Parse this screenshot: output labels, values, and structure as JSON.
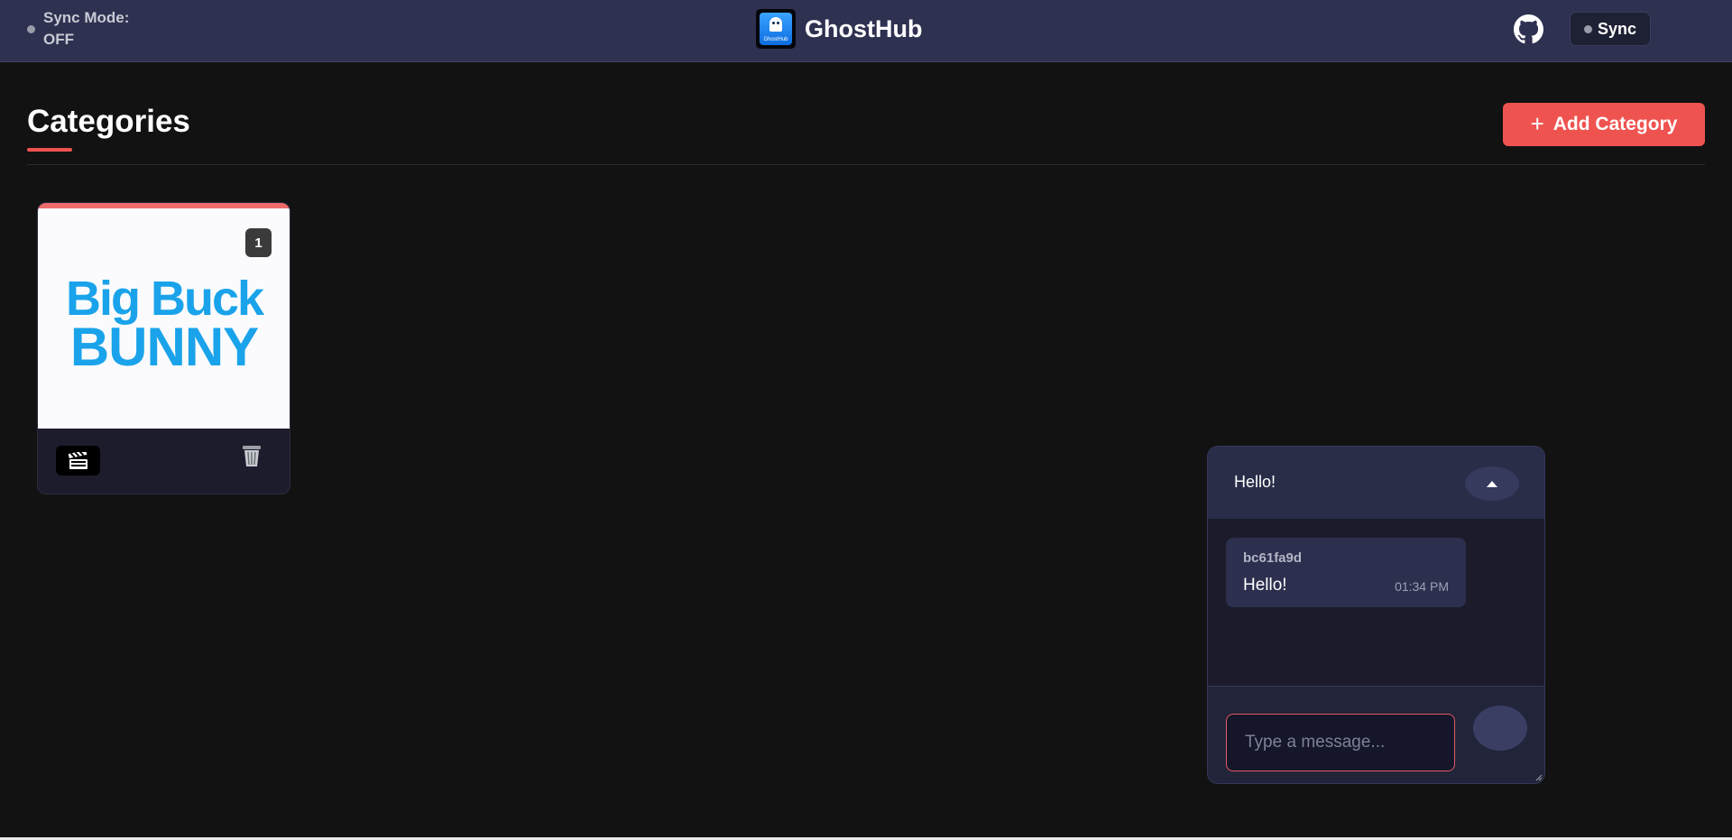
{
  "header": {
    "sync_mode_label": "Sync Mode:",
    "sync_mode_value": "OFF",
    "brand_name": "GhostHub",
    "logo_caption": "GhostHub",
    "github_icon": "github-icon",
    "sync_button_label": "Sync"
  },
  "page": {
    "title": "Categories",
    "add_button_label": "Add Category",
    "add_button_icon": "plus-icon",
    "accent_color": "#ef5350"
  },
  "categories": [
    {
      "thumbnail_text_line1": "Big Buck",
      "thumbnail_text_line2": "BUNNY",
      "media_count": "1",
      "type_icon": "clapperboard-icon",
      "delete_icon": "trash-icon"
    }
  ],
  "chat": {
    "header_title": "Hello!",
    "toggle_icon": "caret-up-icon",
    "messages": [
      {
        "user": "bc61fa9d",
        "text": "Hello!",
        "time": "01:34 PM"
      }
    ],
    "input_placeholder": "Type a message...",
    "send_icon": "send-icon"
  }
}
